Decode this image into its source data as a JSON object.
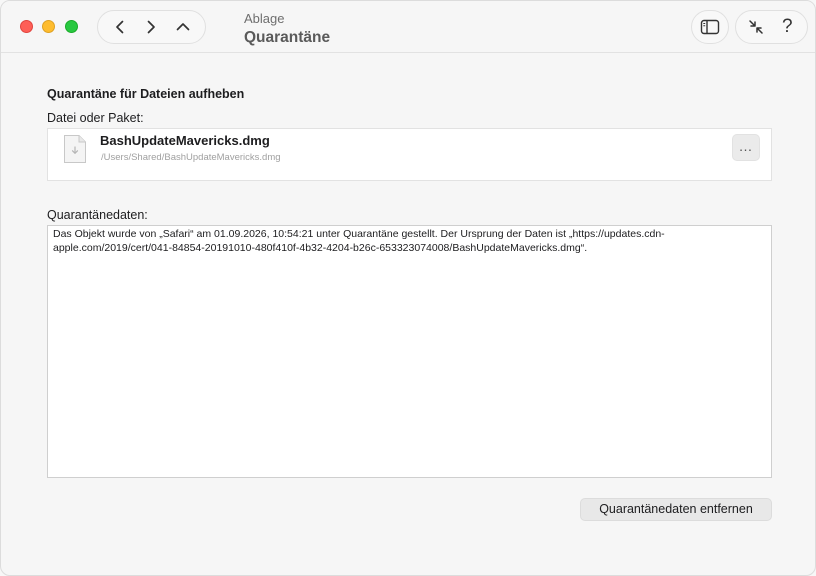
{
  "window": {
    "breadcrumb": "Ablage",
    "title": "Quarantäne"
  },
  "toolbar": {
    "icons": [
      "chevron-left-icon",
      "chevron-right-icon",
      "chevron-up-icon",
      "sidebar-icon",
      "collapse-arrows-icon"
    ],
    "help_label": "?"
  },
  "main": {
    "section_title": "Quarantäne für Dateien aufheben",
    "file_label": "Datei oder Paket:",
    "file": {
      "name": "BashUpdateMavericks.dmg",
      "path": "/Users/Shared/BashUpdateMavericks.dmg",
      "more_label": "…"
    },
    "quarantine_label": "Quarantänedaten:",
    "quarantine_text": "Das Objekt wurde von „Safari“ am 01.09.2026, 10:54:21 unter Quarantäne gestellt. Der Ursprung der Daten ist „https://updates.cdn-apple.com/2019/cert/041-84854-20191010-480f410f-4b32-4204-b26c-653323074008/BashUpdateMavericks.dmg“.",
    "remove_button": "Quarantänedaten entfernen"
  },
  "colors": {
    "close": "#fe5f57",
    "minimize": "#febc2e",
    "maximize": "#28c840"
  }
}
